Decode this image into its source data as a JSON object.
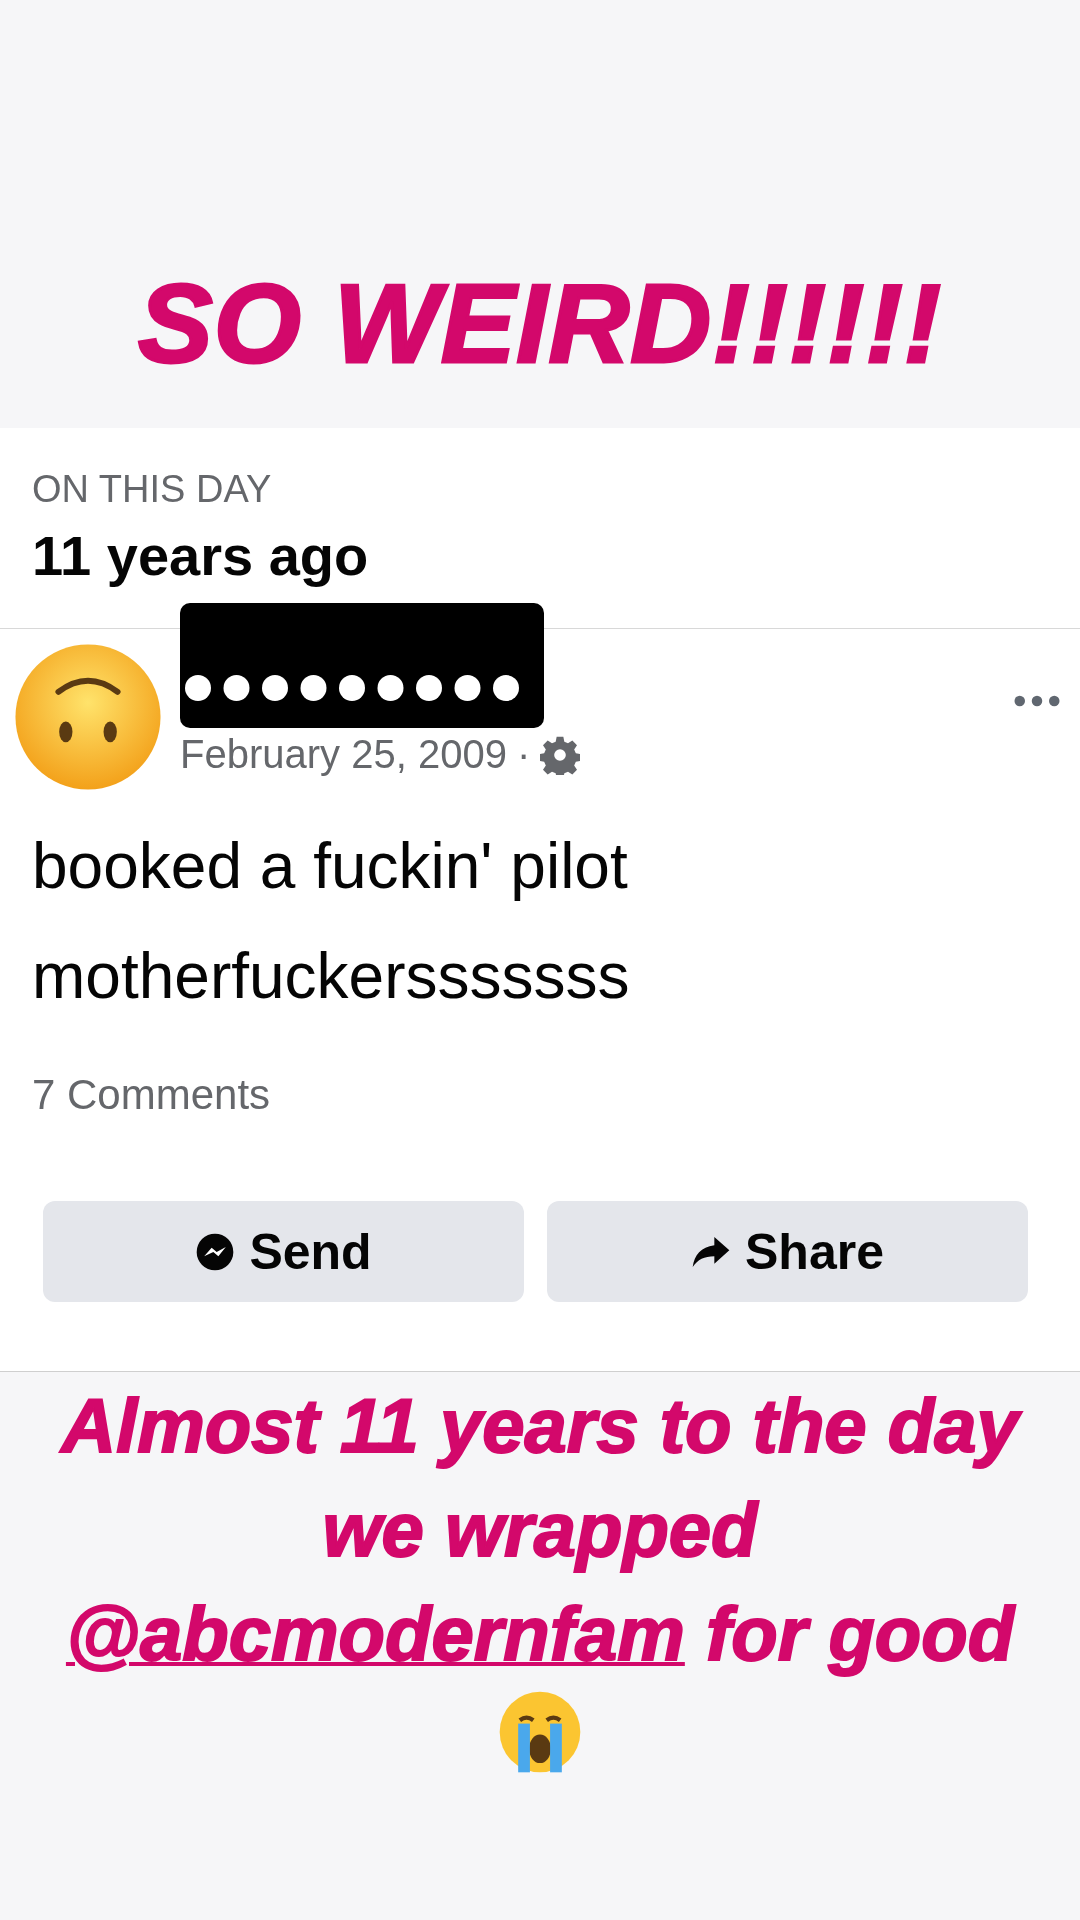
{
  "story_heading": "SO WEIRD!!!!!!",
  "memory": {
    "label": "ON THIS DAY",
    "title": "11 years ago",
    "post": {
      "date": "February 25, 2009",
      "separator": "·",
      "text_lines": [
        "booked a fuckin' pilot",
        "motherfuckersssssss"
      ],
      "comments": "7 Comments"
    },
    "buttons": [
      {
        "kind": "send",
        "label": "Send"
      },
      {
        "kind": "share",
        "label": "Share"
      }
    ]
  },
  "caption": {
    "text": "Almost 11 years to the day we wrapped",
    "mention": "@abcmodernfam",
    "text_after": "for good"
  }
}
